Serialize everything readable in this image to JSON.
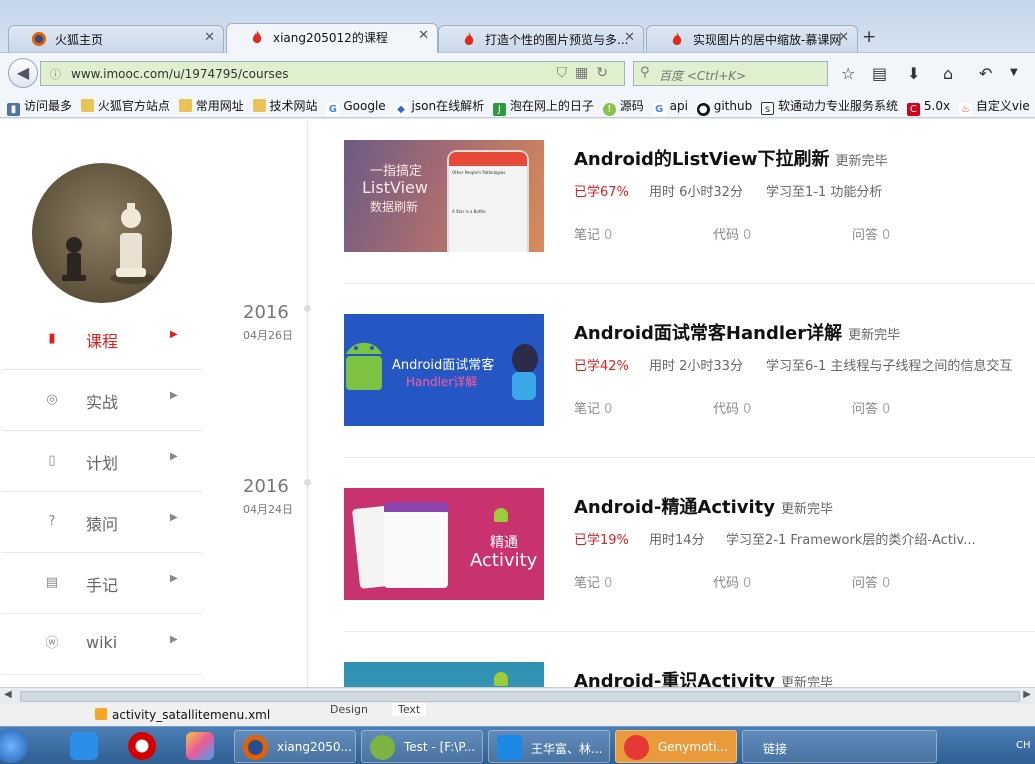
{
  "browser": {
    "tabs": [
      {
        "title": "火狐主页",
        "active": false
      },
      {
        "title": "xiang205012的课程",
        "active": true
      },
      {
        "title": "打造个性的图片预览与多...",
        "active": false
      },
      {
        "title": "实现图片的居中缩放-慕课网",
        "active": false
      }
    ],
    "url": "www.imooc.com/u/1974795/courses",
    "search_placeholder": "百度 <Ctrl+K>",
    "bookmarks": [
      "访问最多",
      "火狐官方站点",
      "常用网址",
      "技术网站",
      "Google",
      "json在线解析",
      "泡在网上的日子",
      "源码",
      "api",
      "github",
      "软通动力专业服务系统",
      "5.0x",
      "自定义vie"
    ]
  },
  "sidebar": {
    "items": [
      {
        "label": "课程",
        "icon": "book-icon",
        "active": true
      },
      {
        "label": "实战",
        "icon": "signal-icon",
        "active": false
      },
      {
        "label": "计划",
        "icon": "clipboard-icon",
        "active": false
      },
      {
        "label": "猿问",
        "icon": "question-icon",
        "active": false
      },
      {
        "label": "手记",
        "icon": "notes-icon",
        "active": false
      },
      {
        "label": "wiki",
        "icon": "wiki-icon",
        "active": false
      }
    ]
  },
  "timeline": [
    {
      "year": "2016",
      "date": "04月26日"
    },
    {
      "year": "2016",
      "date": "04月24日"
    }
  ],
  "courses": [
    {
      "title": "Android的ListView下拉刷新",
      "status": "更新完毕",
      "progress": "已学67%",
      "time": "用时 6小时32分",
      "study": "学习至1-1 功能分析",
      "notes_label": "笔记",
      "notes": "0",
      "code_label": "代码",
      "code": "0",
      "qa_label": "问答",
      "qa": "0",
      "thumb_text1": "一指搞定",
      "thumb_text2": "ListView",
      "thumb_text3": "数据刷新",
      "thumb_mini1": "Other People's Pathologies",
      "thumb_mini2": "A Star is a Bottle"
    },
    {
      "title": "Android面试常客Handler详解",
      "status": "更新完毕",
      "progress": "已学42%",
      "time": "用时 2小时33分",
      "study": "学习至6-1 主线程与子线程之间的信息交互",
      "notes_label": "笔记",
      "notes": "0",
      "code_label": "代码",
      "code": "0",
      "qa_label": "问答",
      "qa": "0",
      "thumb_text1": "Android面试常客",
      "thumb_text2": "Handler详解"
    },
    {
      "title": "Android-精通Activity",
      "status": "更新完毕",
      "progress": "已学19%",
      "time": "用时14分",
      "study": "学习至2-1 Framework层的类介绍-Activ...",
      "notes_label": "笔记",
      "notes": "0",
      "code_label": "代码",
      "code": "0",
      "qa_label": "问答",
      "qa": "0",
      "thumb_text1": "精通",
      "thumb_text2": "Activity"
    },
    {
      "title": "Android-重识Activity",
      "status": "更新完毕"
    }
  ],
  "ide_strip": {
    "file": "activity_satallitemenu.xml",
    "tab1": "Design",
    "tab2": "Text"
  },
  "taskbar": {
    "items": [
      "xiang2050...",
      "Test - [F:\\P...",
      "王华富、林...",
      "Genymoti...",
      "链接"
    ],
    "lang": "CH"
  }
}
